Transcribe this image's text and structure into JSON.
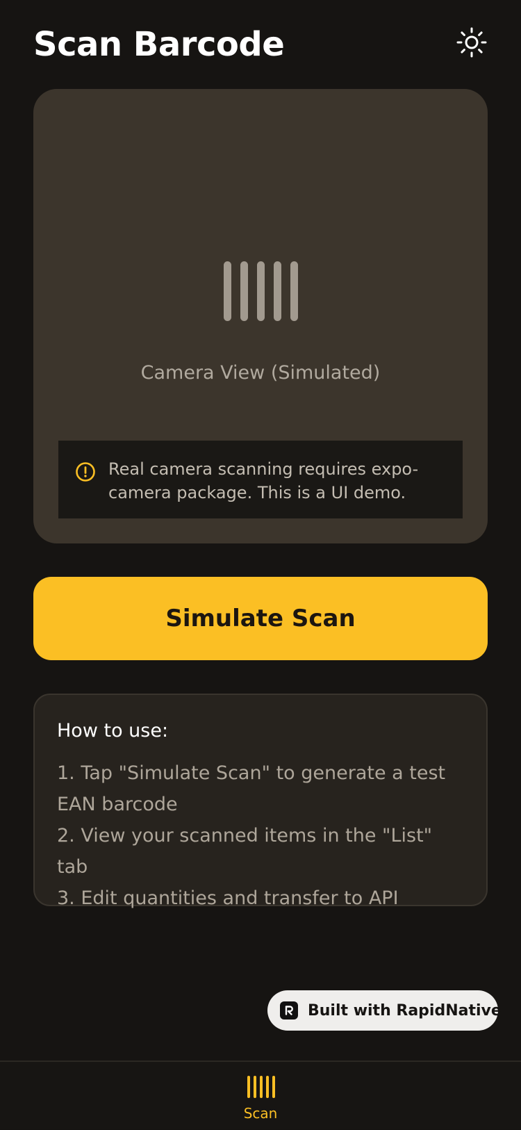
{
  "header": {
    "title": "Scan Barcode",
    "theme_icon": "sun-icon"
  },
  "camera": {
    "placeholder_icon": "barcode-icon",
    "label": "Camera View (Simulated)",
    "notice_icon": "alert-circle-icon",
    "notice": "Real camera scanning requires expo-camera package. This is a UI demo."
  },
  "actions": {
    "simulate_label": "Simulate Scan"
  },
  "help": {
    "title": "How to use:",
    "steps": [
      "1. Tap \"Simulate Scan\" to generate a test EAN barcode",
      "2. View your scanned items in the \"List\" tab",
      "3. Edit quantities and transfer to API"
    ]
  },
  "badge": {
    "label": "Built with RapidNative",
    "logo_text": "R"
  },
  "tabbar": {
    "tabs": [
      {
        "label": "Scan",
        "icon": "barcode-icon",
        "active": true
      }
    ]
  },
  "colors": {
    "background": "#161412",
    "accent": "#fbbf24",
    "card": "#3c352c",
    "help_card": "#27231e"
  }
}
